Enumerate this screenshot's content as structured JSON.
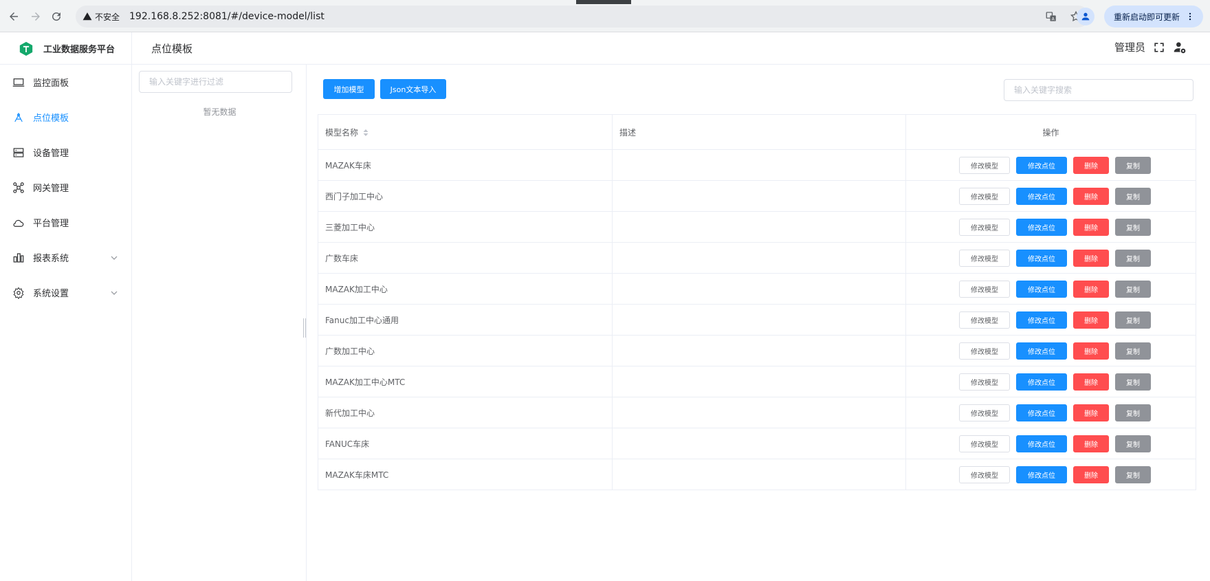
{
  "browser": {
    "insecure_label": "不安全",
    "url": "192.168.8.252:8081/#/device-model/list",
    "update_label": "重新启动即可更新"
  },
  "app": {
    "brand_name": "工业数据服务平台",
    "page_title": "点位模板",
    "admin_name": "管理员"
  },
  "sidebar": {
    "items": [
      {
        "label": "监控面板",
        "icon": "monitor-icon"
      },
      {
        "label": "点位模板",
        "icon": "template-icon",
        "active": true
      },
      {
        "label": "设备管理",
        "icon": "server-icon"
      },
      {
        "label": "网关管理",
        "icon": "gateway-icon"
      },
      {
        "label": "平台管理",
        "icon": "cloud-icon"
      },
      {
        "label": "报表系统",
        "icon": "chart-icon",
        "expandable": true
      },
      {
        "label": "系统设置",
        "icon": "gear-icon",
        "expandable": true
      }
    ]
  },
  "tree": {
    "filter_placeholder": "输入关键字进行过滤",
    "empty_text": "暂无数据"
  },
  "toolbar": {
    "add_model_label": "增加模型",
    "json_import_label": "Json文本导入",
    "search_placeholder": "输入关键字搜索"
  },
  "table": {
    "columns": [
      "模型名称",
      "描述",
      "操作"
    ],
    "action_labels": {
      "edit_model": "修改模型",
      "edit_points": "修改点位",
      "delete": "删除",
      "copy": "复制"
    },
    "rows": [
      {
        "name": "MAZAK车床",
        "description": ""
      },
      {
        "name": "西门子加工中心",
        "description": ""
      },
      {
        "name": "三菱加工中心",
        "description": ""
      },
      {
        "name": "广数车床",
        "description": ""
      },
      {
        "name": "MAZAK加工中心",
        "description": ""
      },
      {
        "name": "Fanuc加工中心通用",
        "description": ""
      },
      {
        "name": "广数加工中心",
        "description": ""
      },
      {
        "name": "MAZAK加工中心MTC",
        "description": ""
      },
      {
        "name": "新代加工中心",
        "description": ""
      },
      {
        "name": "FANUC车床",
        "description": ""
      },
      {
        "name": "MAZAK车床MTC",
        "description": ""
      }
    ]
  },
  "colors": {
    "primary": "#1890ff",
    "danger": "#ff4d4f",
    "info": "#909399",
    "brand_green": "#13a86b"
  }
}
